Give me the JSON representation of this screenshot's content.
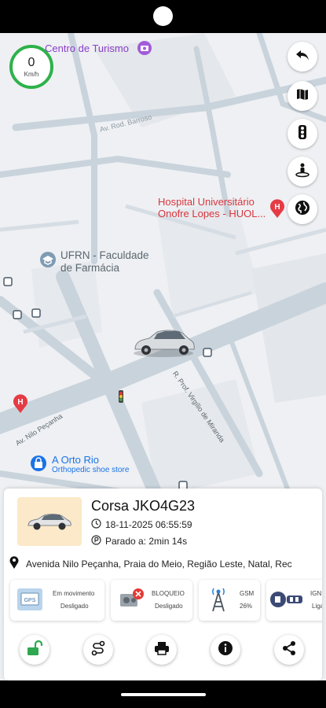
{
  "speedometer": {
    "value": "0",
    "unit": "Km/h"
  },
  "map": {
    "pois": {
      "tourism": "Centro de Turismo",
      "hospital_line1": "Hospital Universitário",
      "hospital_line2": "Onofre Lopes -  HUOL...",
      "faculty_line1": "UFRN - Faculdade",
      "faculty_line2": "de Farmácia",
      "orto_name": "A Orto Rio",
      "orto_sub": "Orthopedic shoe store"
    },
    "roads": {
      "nilo": "Av. Nilo Peçanha",
      "virgilio": "R. Prof. Virgílio de Miranda",
      "top_street": "Av. Rod. Barroso"
    }
  },
  "map_controls": [
    "back-icon",
    "map-icon",
    "traffic-icon",
    "street-view-icon",
    "globe-icon"
  ],
  "vehicle": {
    "name": "Corsa JKO4G23",
    "datetime": "18-11-2025 06:55:59",
    "status": "Parado a: 2min 14s",
    "address": "Avenida Nilo Peçanha, Praia do Meio, Região Leste, Natal, Rec"
  },
  "status_cards": [
    {
      "title": "Em movimento",
      "value": "Desligado"
    },
    {
      "title": "BLOQUEIO",
      "value": "Desligado"
    },
    {
      "title": "GSM",
      "value": "26%"
    },
    {
      "title": "IGNIÇ",
      "value": "Ligad"
    }
  ],
  "actions": [
    "unlock-icon",
    "route-icon",
    "printer-icon",
    "info-icon",
    "share-icon"
  ],
  "colors": {
    "speed_ring": "#2db24a",
    "unlock": "#2fa84f",
    "hospital": "#d9363e",
    "tourism": "#8a3ec9",
    "link": "#1a73e8"
  }
}
